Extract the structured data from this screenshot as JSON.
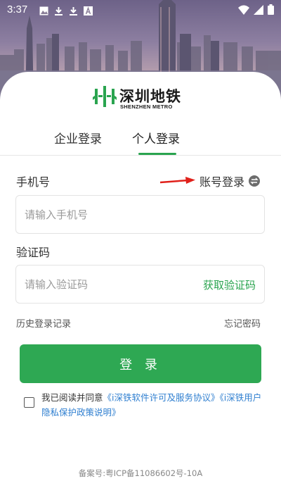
{
  "status_bar": {
    "time": "3:37",
    "left_icons": [
      "image-icon",
      "download-icon",
      "download-icon",
      "font-icon"
    ],
    "right_icons": [
      "wifi-icon",
      "signal-icon",
      "battery-icon"
    ]
  },
  "logo": {
    "name_cn": "深圳地铁",
    "name_en": "SHENZHEN METRO",
    "brand_color": "#2aa44f"
  },
  "tabs": [
    {
      "label": "企业登录",
      "active": false
    },
    {
      "label": "个人登录",
      "active": true
    }
  ],
  "form": {
    "phone_label": "手机号",
    "switch_label": "账号登录",
    "phone_placeholder": "请输入手机号",
    "code_label": "验证码",
    "code_placeholder": "请输入验证码",
    "get_code_label": "获取验证码",
    "history_label": "历史登录记录",
    "forgot_label": "忘记密码",
    "login_label": "登 录"
  },
  "agreement": {
    "checked": false,
    "prefix": "我已阅读并同意",
    "link1": "《i深铁软件许可及服务协议》",
    "link2": "《i深铁用户隐私保护政策说明》"
  },
  "footer": {
    "icp": "备案号:粤ICP备11086602号-10A"
  },
  "colors": {
    "accent": "#2aa44f",
    "button": "#2ea853",
    "link": "#2f7fd0",
    "arrow": "#e0201a"
  }
}
